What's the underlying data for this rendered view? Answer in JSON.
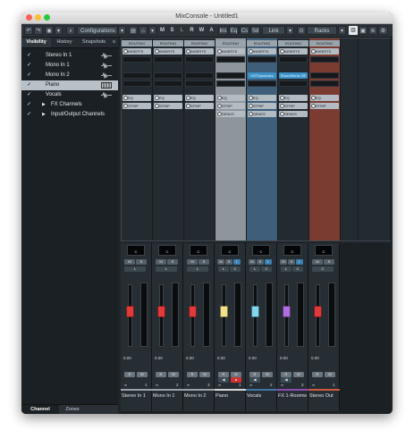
{
  "window": {
    "title": "MixConsole - Untitled1"
  },
  "toolbar": {
    "configurations": "Configurations",
    "modes": [
      "M",
      "S",
      "L",
      "R",
      "W",
      "A"
    ],
    "ins_buttons": [
      "Ins",
      "Eq",
      "Cs",
      "Sd"
    ],
    "link": "Link",
    "racks": "Racks"
  },
  "sidebar": {
    "tabs": [
      "Visibility",
      "History",
      "Snapshots"
    ],
    "rows": [
      {
        "label": "Stereo In 1",
        "checked": true
      },
      {
        "label": "Mono In 1",
        "checked": true
      },
      {
        "label": "Mono In 2",
        "checked": true
      },
      {
        "label": "Piano",
        "checked": true,
        "selected": true
      },
      {
        "label": "Vocals",
        "checked": true
      },
      {
        "label": "FX Channels",
        "folder": true
      },
      {
        "label": "Input/Output Channels",
        "folder": true
      }
    ],
    "bottom_tabs": [
      "Channel",
      "Zones"
    ]
  },
  "rack": {
    "routing": "ROUTING",
    "inserts": "INSERTS",
    "eq": "EQ",
    "strip": "STRIP",
    "sends": "SENDS",
    "plugins": [
      "VSTDynamics",
      "RoomWorks SE"
    ]
  },
  "mixer": {
    "pan": "C",
    "volume": "0.00",
    "channels": [
      {
        "name": "Stereo In 1",
        "number": "1",
        "color": "#9aa3aa",
        "fader_color": "#e23a3a",
        "row1": [
          "M",
          "S"
        ],
        "row2": [
          "L"
        ]
      },
      {
        "name": "Mono In 1",
        "number": "2",
        "color": "#9aa3aa",
        "fader_color": "#e23a3a",
        "row1": [
          "M",
          "S"
        ],
        "row2": [
          "L"
        ]
      },
      {
        "name": "Mono In 2",
        "number": "3",
        "color": "#9aa3aa",
        "fader_color": "#e23a3a",
        "row1": [
          "M",
          "S"
        ],
        "row2": [
          "L"
        ]
      },
      {
        "name": "Piano",
        "number": "1",
        "color": "#d7d7d7",
        "fader_color": "#f1e28a",
        "row1": [
          "M",
          "S",
          "L"
        ],
        "row2": [
          "L",
          "C"
        ]
      },
      {
        "name": "Vocals",
        "number": "2",
        "color": "#3f78a8",
        "fader_color": "#7fd8f0",
        "row1": [
          "M",
          "S",
          "L"
        ],
        "row2": [
          "L",
          "C"
        ]
      },
      {
        "name": "FX 1-Roomwor",
        "number": "3",
        "color": "#8d4bb3",
        "fader_color": "#b06ee0",
        "row1": [
          "M",
          "S",
          "L"
        ],
        "row2": [
          "L",
          "C"
        ]
      },
      {
        "name": "Stereo Out",
        "number": "1",
        "color": "#d05a3a",
        "fader_color": "#e23a3a",
        "row1": [
          "M",
          "S"
        ],
        "row2": [
          "C"
        ]
      }
    ],
    "rw": [
      "R",
      "W"
    ]
  },
  "colors": {
    "piano_strip": "#8f969b",
    "vocals_strip": "#3e5e7a",
    "out_strip": "#7a3b31",
    "selection": "#b9c1c8",
    "plugin": "#3b92c8"
  }
}
